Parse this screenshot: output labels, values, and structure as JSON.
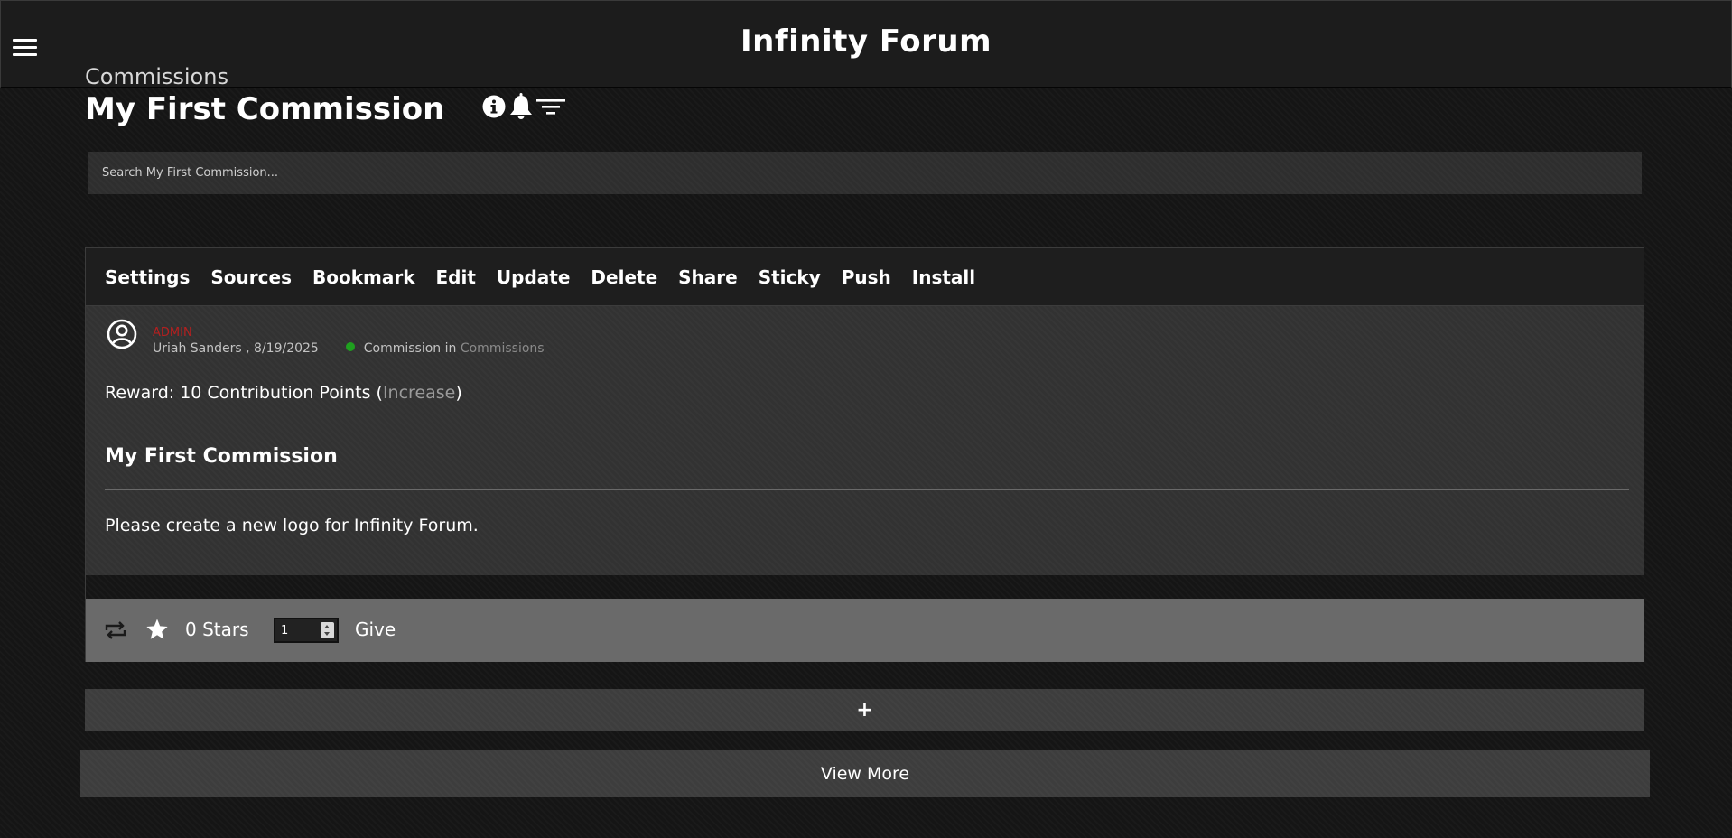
{
  "header": {
    "site_title": "Infinity Forum",
    "menu_icon": "hamburger-menu-icon"
  },
  "page": {
    "breadcrumb": "Commissions",
    "title": "My First Commission",
    "icons": [
      "info-icon",
      "bell-icon",
      "filter-icon"
    ]
  },
  "search": {
    "placeholder": "Search My First Commission...",
    "value": ""
  },
  "toolbar": {
    "buttons": [
      "Settings",
      "Sources",
      "Bookmark",
      "Edit",
      "Update",
      "Delete",
      "Share",
      "Sticky",
      "Push",
      "Install"
    ]
  },
  "post": {
    "role": "ADMIN",
    "author": "Uriah Sanders",
    "date": "8/19/2025",
    "type_label": "Commission in",
    "category": "Commissions",
    "reward_prefix": "Reward: 10 Contribution Points (",
    "reward_link": "Increase",
    "reward_suffix": ")",
    "title": "My First Commission",
    "body": "Please create a new logo for Infinity Forum."
  },
  "actions": {
    "stars_label": "0 Stars",
    "give_amount": "1",
    "give_label": "Give"
  },
  "add_button": "+",
  "view_more": "View More",
  "colors": {
    "background": "#151515",
    "role_red": "#b51f1f",
    "status_green": "#1fa01f",
    "action_bar": "#6a6a6a"
  }
}
